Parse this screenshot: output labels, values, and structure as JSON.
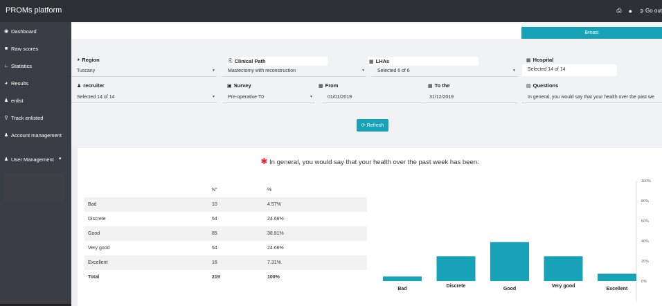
{
  "app": {
    "title": "PROMs platform",
    "go_out_label": "Go out"
  },
  "sidebar": {
    "items": [
      {
        "label": "Dashboard",
        "icon": "tachometer-icon"
      },
      {
        "label": "Raw scores",
        "icon": "square-icon"
      },
      {
        "label": "Statistics",
        "icon": "line-chart-icon"
      },
      {
        "label": "Results",
        "icon": "globe-icon"
      },
      {
        "label": "enlist",
        "icon": "user-icon"
      },
      {
        "label": "Track enlisted",
        "icon": "search-icon"
      },
      {
        "label": "Account management",
        "icon": "users-icon"
      },
      {
        "label": "User Management",
        "icon": "group-icon"
      }
    ]
  },
  "tab": {
    "label": "Breast"
  },
  "filters": {
    "region": {
      "label": "Region",
      "value": "Tuscany"
    },
    "clinical_path": {
      "label": "Clinical Path",
      "value": "Mastectomy with reconstruction"
    },
    "lhas": {
      "label": "LHAs",
      "value": "Selected 6 of 6"
    },
    "hospital": {
      "label": "Hospital",
      "value": "Selected 14 of 14"
    },
    "recruiter": {
      "label": "recruiter",
      "value": "Selected 14 of 14"
    },
    "survey": {
      "label": "Survey",
      "value": "Pre-operative T0"
    },
    "from": {
      "label": "From",
      "value": "01/01/2019"
    },
    "to": {
      "label": "To the",
      "value": "31/12/2019"
    },
    "questions": {
      "label": "Questions",
      "value": "In general, you would say that your health over the past we"
    }
  },
  "refresh": {
    "label": "Refresh"
  },
  "question": {
    "title": "In general, you would say that your health over the past week has been:"
  },
  "table": {
    "headers": [
      "",
      "N°",
      "%"
    ],
    "rows": [
      [
        "Bad",
        "10",
        "4.57%"
      ],
      [
        "Discrete",
        "54",
        "24.66%"
      ],
      [
        "Good",
        "85",
        "38.81%"
      ],
      [
        "Very good",
        "54",
        "24.66%"
      ],
      [
        "Excellent",
        "16",
        "7.31%"
      ]
    ],
    "total": [
      "Total",
      "219",
      "100%"
    ]
  },
  "chart_data": {
    "type": "bar",
    "categories": [
      "Bad",
      "Discrete",
      "Good",
      "Very good",
      "Excellent"
    ],
    "values": [
      4.57,
      24.66,
      38.81,
      24.66,
      7.31
    ],
    "ylim": [
      0,
      100
    ],
    "yticks": [
      "0%",
      "20%",
      "40%",
      "60%",
      "80%",
      "100%"
    ],
    "color": "#17a2b8",
    "grid": false
  }
}
